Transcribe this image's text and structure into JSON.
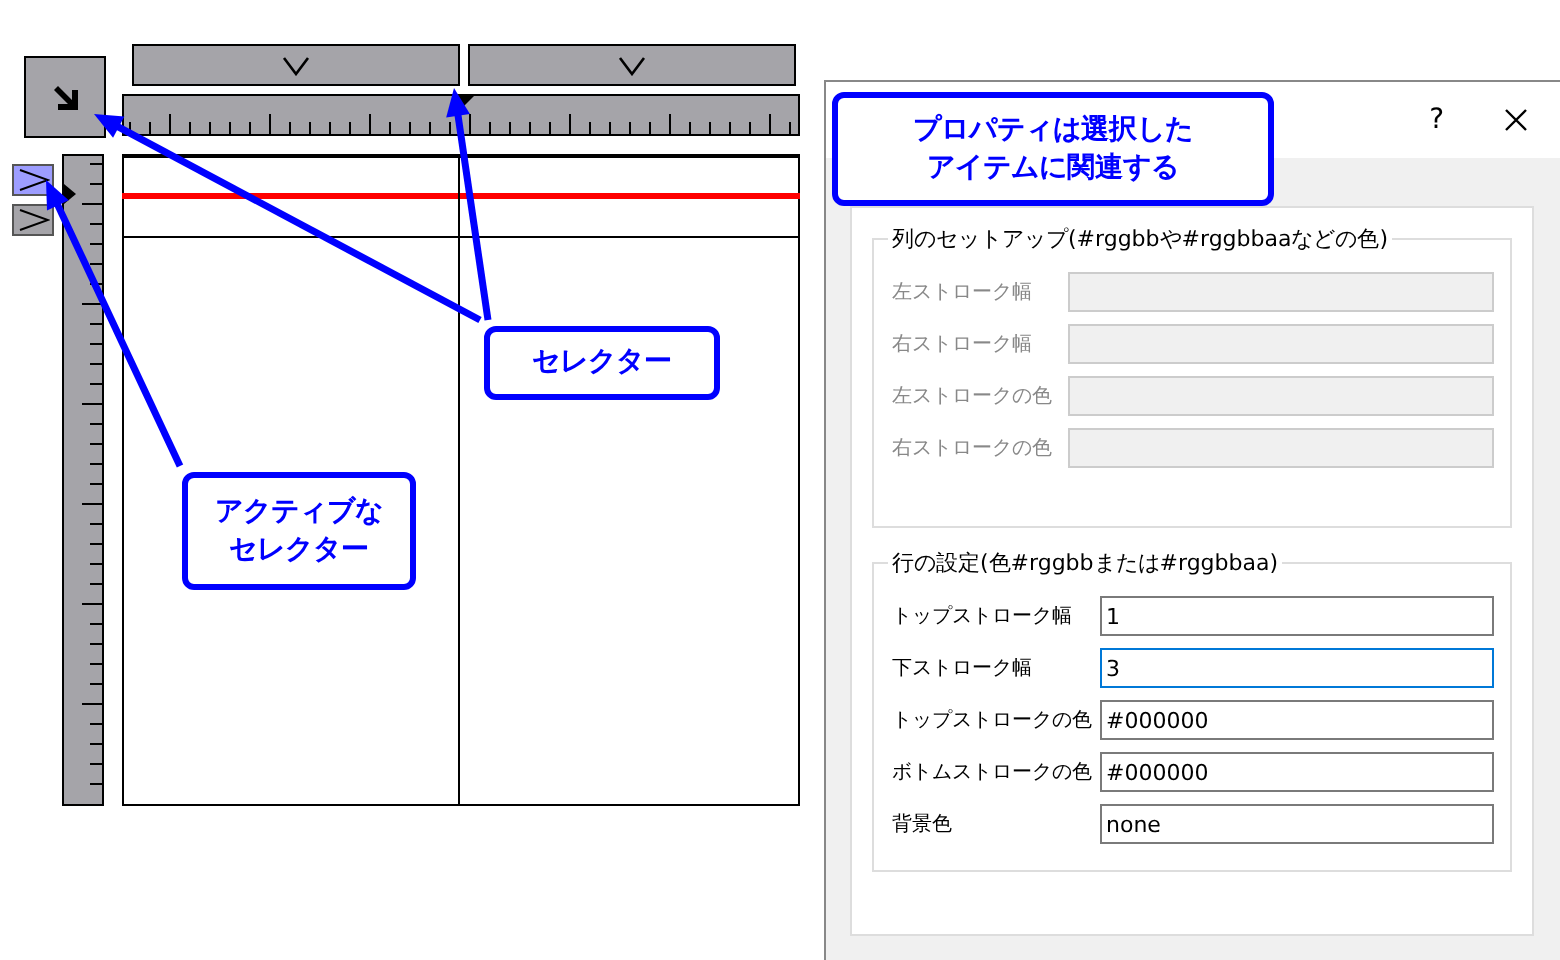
{
  "editor": {
    "column_selectors": [
      {
        "selected": false
      },
      {
        "selected": false
      }
    ],
    "row_selectors": [
      {
        "selected": true
      },
      {
        "selected": false
      }
    ]
  },
  "callouts": [
    {
      "kind": "selector-active",
      "lines": [
        "アクティブな",
        "セレクター"
      ]
    },
    {
      "kind": "selector",
      "lines": [
        "セレクター"
      ]
    },
    {
      "kind": "properties",
      "lines": [
        "プロパティは選択した",
        "アイテムに関連する"
      ]
    }
  ],
  "dialog": {
    "help": "?",
    "column_group": {
      "title": "列のセットアップ(#rggbbや#rggbbaaなどの色)",
      "fields": [
        {
          "label": "左ストローク幅",
          "disabled": true,
          "focused": false
        },
        {
          "label": "右ストローク幅",
          "disabled": true,
          "focused": false
        },
        {
          "label": "左ストロークの色",
          "disabled": true,
          "focused": false
        },
        {
          "label": "右ストロークの色",
          "disabled": true,
          "focused": false
        }
      ]
    },
    "row_group": {
      "title": "行の設定(色#rggbbまたは#rggbbaa)",
      "fields": [
        {
          "label": "トップストローク幅",
          "value": "1",
          "disabled": false,
          "focused": false
        },
        {
          "label": "下ストローク幅",
          "value": "3",
          "disabled": false,
          "focused": true
        },
        {
          "label": "トップストロークの色",
          "value": "#000000",
          "disabled": false,
          "focused": false
        },
        {
          "label": "ボトムストロークの色",
          "value": "#000000",
          "disabled": false,
          "focused": false
        },
        {
          "label": "背景色",
          "value": "none",
          "disabled": false,
          "focused": false
        }
      ]
    }
  }
}
